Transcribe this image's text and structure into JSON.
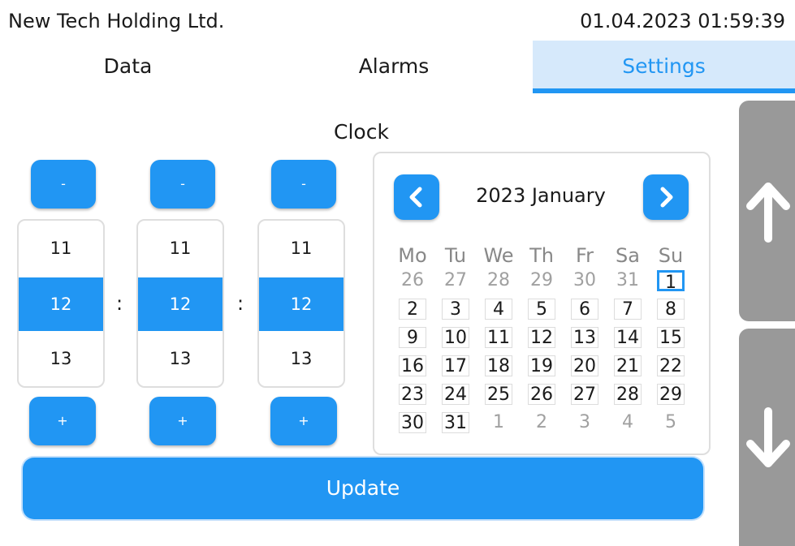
{
  "header": {
    "company": "New Tech Holding Ltd.",
    "datetime": "01.04.2023 01:59:39"
  },
  "tabs": [
    {
      "label": "Data",
      "active": false
    },
    {
      "label": "Alarms",
      "active": false
    },
    {
      "label": "Settings",
      "active": true
    }
  ],
  "clock": {
    "title": "Clock",
    "minus_label": "-",
    "plus_label": "+",
    "separator": ":",
    "rollers": [
      {
        "values": [
          "11",
          "12",
          "13"
        ],
        "selected": "12"
      },
      {
        "values": [
          "11",
          "12",
          "13"
        ],
        "selected": "12"
      },
      {
        "values": [
          "11",
          "12",
          "13"
        ],
        "selected": "12"
      }
    ]
  },
  "calendar": {
    "title": "2023 January",
    "prev_icon": "chevron-left-icon",
    "next_icon": "chevron-right-icon",
    "weekdays": [
      "Mo",
      "Tu",
      "We",
      "Th",
      "Fr",
      "Sa",
      "Su"
    ],
    "weeks": [
      [
        "26",
        "27",
        "28",
        "29",
        "30",
        "31",
        "1"
      ],
      [
        "2",
        "3",
        "4",
        "5",
        "6",
        "7",
        "8"
      ],
      [
        "9",
        "10",
        "11",
        "12",
        "13",
        "14",
        "15"
      ],
      [
        "16",
        "17",
        "18",
        "19",
        "20",
        "21",
        "22"
      ],
      [
        "23",
        "24",
        "25",
        "26",
        "27",
        "28",
        "29"
      ],
      [
        "30",
        "31",
        "1",
        "2",
        "3",
        "4",
        "5"
      ]
    ],
    "highlighted_day": "1"
  },
  "update_label": "Update",
  "side_buttons": {
    "up_icon": "arrow-up-icon",
    "down_icon": "arrow-down-icon"
  },
  "colors": {
    "accent": "#2196f3",
    "tab_active_bg": "#d6e9fb",
    "side_button": "#999999"
  }
}
